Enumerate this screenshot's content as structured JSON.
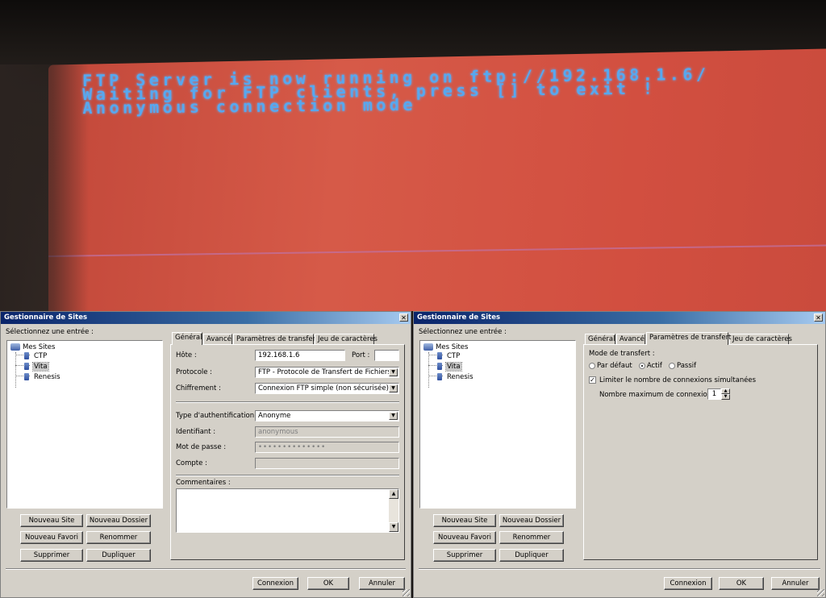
{
  "tv_screen": {
    "lines": [
      "FTP Server is now running on ftp://192.168.1.6/",
      "Waiting for FTP clients, press [] to exit !",
      "Anonymous connection mode"
    ]
  },
  "left_dialog": {
    "title": "Gestionnaire de Sites",
    "close_label": "✕",
    "select_label": "Sélectionnez une entrée :",
    "tree": {
      "root": "Mes Sites",
      "items": [
        "CTP",
        "Vita",
        "Renesis"
      ],
      "selected": "Vita"
    },
    "buttons": {
      "new_site": "Nouveau Site",
      "new_folder": "Nouveau Dossier",
      "new_favorite": "Nouveau Favori",
      "rename": "Renommer",
      "delete": "Supprimer",
      "duplicate": "Dupliquer"
    },
    "tabs": [
      "Général",
      "Avancé",
      "Paramètres de transfert",
      "Jeu de caractères"
    ],
    "active_tab": "Général",
    "general": {
      "host_label": "Hôte :",
      "host_value": "192.168.1.6",
      "port_label": "Port :",
      "port_value": "",
      "protocol_label": "Protocole :",
      "protocol_value": "FTP - Protocole de Transfert de Fichiers",
      "encryption_label": "Chiffrement :",
      "encryption_value": "Connexion FTP simple (non sécurisée)",
      "auth_label": "Type d'authentification :",
      "auth_value": "Anonyme",
      "user_label": "Identifiant :",
      "user_value": "anonymous",
      "password_label": "Mot de passe :",
      "password_value": "••••••••••••••",
      "account_label": "Compte :",
      "account_value": "",
      "comments_label": "Commentaires :"
    },
    "footer": {
      "connect": "Connexion",
      "ok": "OK",
      "cancel": "Annuler"
    }
  },
  "right_dialog": {
    "title": "Gestionnaire de Sites",
    "close_label": "✕",
    "select_label": "Sélectionnez une entrée :",
    "tree": {
      "root": "Mes Sites",
      "items": [
        "CTP",
        "Vita",
        "Renesis"
      ],
      "selected": "Vita"
    },
    "buttons": {
      "new_site": "Nouveau Site",
      "new_folder": "Nouveau Dossier",
      "new_favorite": "Nouveau Favori",
      "rename": "Renommer",
      "delete": "Supprimer",
      "duplicate": "Dupliquer"
    },
    "tabs": [
      "Général",
      "Avancé",
      "Paramètres de transfert",
      "Jeu de caractères"
    ],
    "active_tab": "Paramètres de transfert",
    "transfer": {
      "mode_label": "Mode de transfert :",
      "mode_options": [
        "Par défaut",
        "Actif",
        "Passif"
      ],
      "mode_selected": "Actif",
      "limit_label": "Limiter le nombre de connexions simultanées",
      "limit_checked": true,
      "limit_check_glyph": "✓",
      "max_label": "Nombre maximum de connexions :",
      "max_value": "1"
    },
    "footer": {
      "connect": "Connexion",
      "ok": "OK",
      "cancel": "Annuler"
    }
  }
}
